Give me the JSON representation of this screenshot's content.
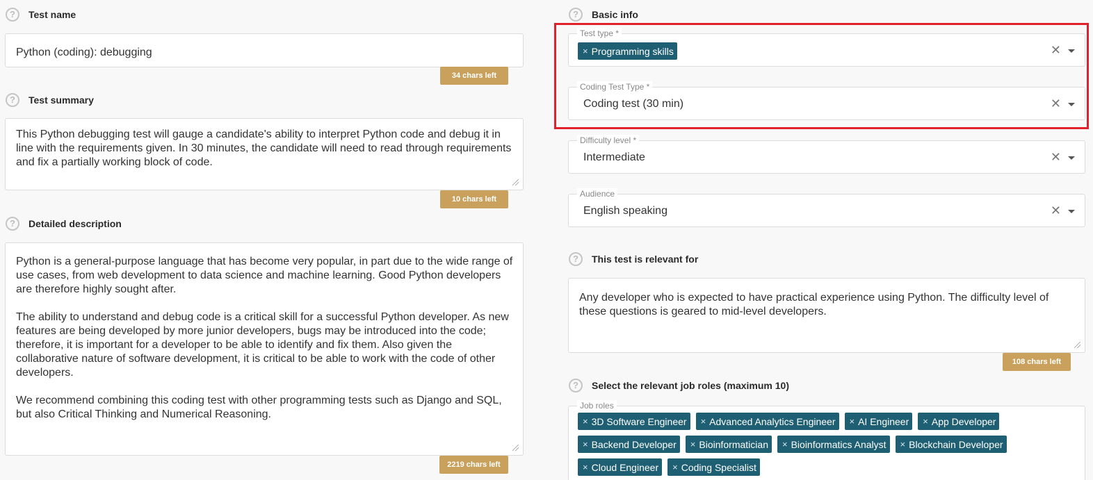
{
  "left": {
    "test_name": {
      "label": "Test name",
      "value": "Python (coding): debugging",
      "chars_left": "34 chars left"
    },
    "test_summary": {
      "label": "Test summary",
      "value": "This Python debugging test will gauge a candidate's ability to interpret Python code and debug it in line with the requirements given. In 30 minutes, the candidate will need to read through requirements and fix a partially working block of code.",
      "chars_left": "10 chars left"
    },
    "detailed_description": {
      "label": "Detailed description",
      "paragraph1": "Python is a general-purpose language that has become very popular, in part due to the wide range of use cases, from web development to data science and machine learning. Good Python developers are therefore highly sought after.",
      "paragraph2": "The ability to understand and debug code is a critical skill for a successful Python developer. As new features are being developed by more junior developers, bugs may be introduced into the code; therefore, it is important for a developer to be able to identify and fix them. Also given the collaborative nature of software development, it is critical to be able to work with the code of other developers.",
      "paragraph3": "We recommend combining this coding test with other programming tests such as Django and SQL, but also Critical Thinking and Numerical Reasoning.",
      "chars_left": "2219 chars left"
    }
  },
  "right": {
    "basic_info": {
      "label": "Basic info"
    },
    "test_type": {
      "label": "Test type *",
      "chip": "Programming skills"
    },
    "coding_test_type": {
      "label": "Coding Test Type *",
      "value": "Coding test (30 min)"
    },
    "difficulty_level": {
      "label": "Difficulty level *",
      "value": "Intermediate"
    },
    "audience": {
      "label": "Audience",
      "value": "English speaking"
    },
    "relevant_for": {
      "label": "This test is relevant for",
      "value": "Any developer who is expected to have practical experience using Python. The difficulty level of these questions is geared to mid-level developers.",
      "chars_left": "108 chars left"
    },
    "job_roles": {
      "section_label": "Select the relevant job roles (maximum 10)",
      "field_label": "Job roles",
      "chips": [
        "3D Software Engineer",
        "Advanced Analytics Engineer",
        "AI Engineer",
        "App Developer",
        "Backend Developer",
        "Bioinformatician",
        "Bioinformatics Analyst",
        "Blockchain Developer",
        "Cloud Engineer",
        "Coding Specialist"
      ]
    }
  },
  "icons": {
    "help": "?",
    "remove": "×",
    "clear": "✕"
  },
  "colors": {
    "chip": "#1f5f73",
    "chars_badge": "#c9a15c",
    "highlight": "#e0202a"
  }
}
